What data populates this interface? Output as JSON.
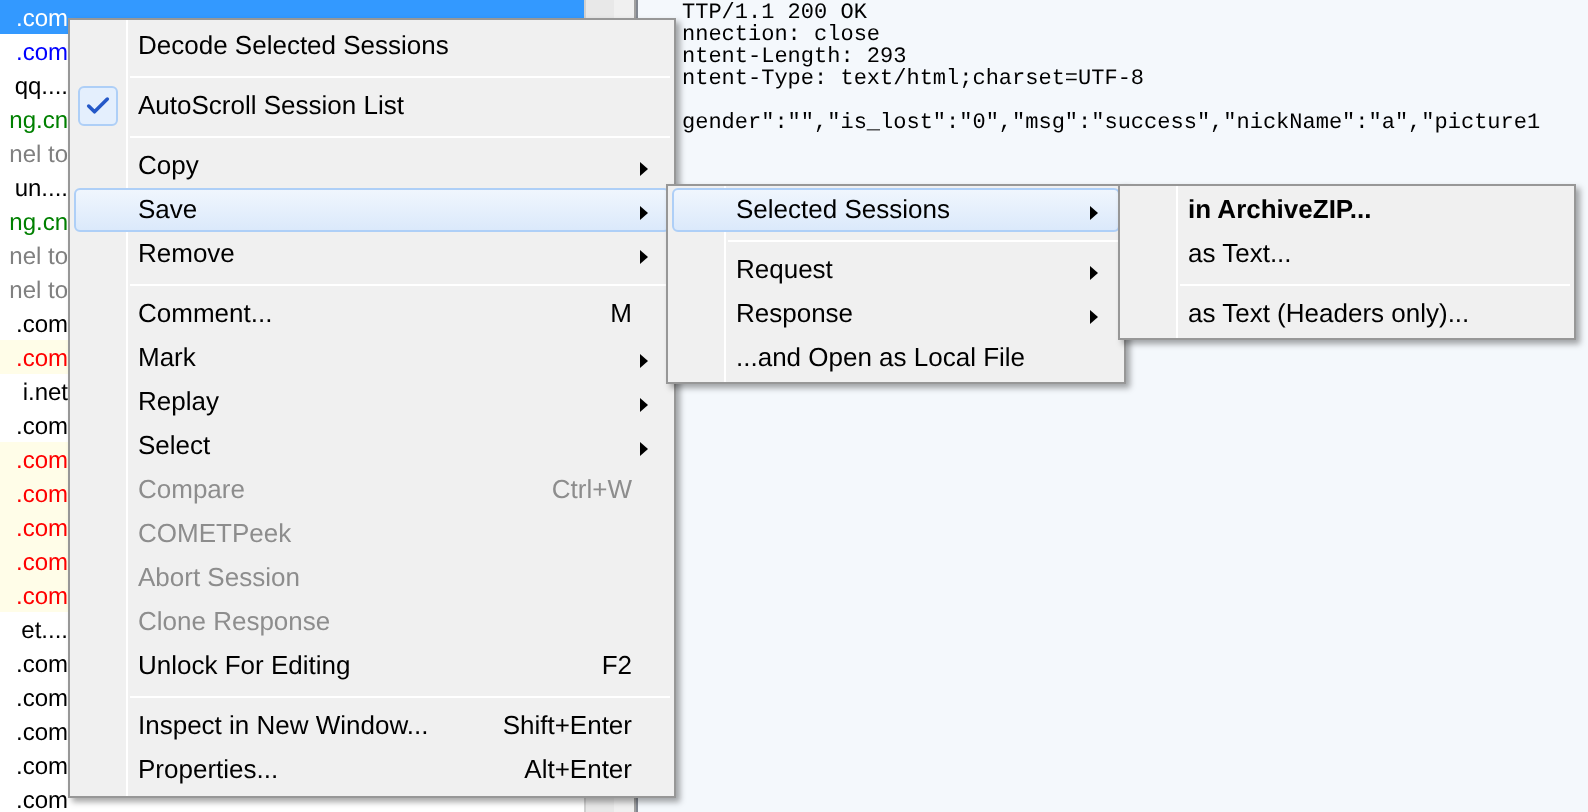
{
  "session_list": {
    "rows": [
      {
        "host": ".com",
        "selected": true,
        "flagged": false
      },
      {
        "host": ".com",
        "color": "#0000ff",
        "selected": false,
        "flagged": false
      },
      {
        "host": "qq....",
        "color": "#000000",
        "selected": false,
        "flagged": false
      },
      {
        "host": "ng.cn",
        "color": "#008000",
        "selected": false,
        "flagged": false
      },
      {
        "host": "nel to",
        "color": "#808080",
        "selected": false,
        "flagged": false
      },
      {
        "host": "un....",
        "color": "#000000",
        "selected": false,
        "flagged": false
      },
      {
        "host": "ng.cn",
        "color": "#008000",
        "selected": false,
        "flagged": false
      },
      {
        "host": "nel to",
        "color": "#808080",
        "selected": false,
        "flagged": false
      },
      {
        "host": "nel to",
        "color": "#808080",
        "selected": false,
        "flagged": false
      },
      {
        "host": ".com",
        "color": "#000000",
        "selected": false,
        "flagged": false
      },
      {
        "host": ".com",
        "color": "#ff0000",
        "selected": false,
        "flagged": true
      },
      {
        "host": "i.net",
        "color": "#000000",
        "selected": false,
        "flagged": false
      },
      {
        "host": ".com",
        "color": "#000000",
        "selected": false,
        "flagged": false
      },
      {
        "host": ".com",
        "color": "#ff0000",
        "selected": false,
        "flagged": true
      },
      {
        "host": ".com",
        "color": "#ff0000",
        "selected": false,
        "flagged": true
      },
      {
        "host": ".com",
        "color": "#ff0000",
        "selected": false,
        "flagged": true
      },
      {
        "host": ".com",
        "color": "#ff0000",
        "selected": false,
        "flagged": true
      },
      {
        "host": ".com",
        "color": "#ff0000",
        "selected": false,
        "flagged": true
      },
      {
        "host": "et....",
        "color": "#000000",
        "selected": false,
        "flagged": false
      },
      {
        "host": ".com",
        "color": "#000000",
        "selected": false,
        "flagged": false
      },
      {
        "host": ".com",
        "color": "#000000",
        "selected": false,
        "flagged": false
      },
      {
        "host": ".com",
        "color": "#000000",
        "selected": false,
        "flagged": false
      },
      {
        "host": ".com",
        "color": "#000000",
        "selected": false,
        "flagged": false
      },
      {
        "host": ".com",
        "color": "#000000",
        "selected": false,
        "flagged": false
      }
    ]
  },
  "response_view": {
    "headers": [
      "TTP/1.1 200 OK",
      "nnection: close",
      "ntent-Length: 293",
      "ntent-Type: text/html;charset=UTF-8"
    ],
    "body": "gender\":\"\",\"is_lost\":\"0\",\"msg\":\"success\",\"nickName\":\"a\",\"picture1"
  },
  "menus": [
    {
      "items": [
        {
          "kind": "command",
          "label": "Decode Selected Sessions",
          "submenu": false,
          "disabled": false,
          "selected": false,
          "checked": false
        },
        {
          "kind": "separator"
        },
        {
          "kind": "command",
          "label": "AutoScroll Session List",
          "submenu": false,
          "disabled": false,
          "selected": false,
          "checked": true
        },
        {
          "kind": "separator"
        },
        {
          "kind": "command",
          "label": "Copy",
          "submenu": true,
          "disabled": false,
          "selected": false,
          "checked": false
        },
        {
          "kind": "command",
          "label": "Save",
          "submenu": true,
          "disabled": false,
          "selected": true,
          "checked": false
        },
        {
          "kind": "command",
          "label": "Remove",
          "submenu": true,
          "disabled": false,
          "selected": false,
          "checked": false
        },
        {
          "kind": "separator"
        },
        {
          "kind": "command",
          "label": "Comment...",
          "shortcut": "M",
          "submenu": false,
          "disabled": false,
          "selected": false,
          "checked": false
        },
        {
          "kind": "command",
          "label": "Mark",
          "submenu": true,
          "disabled": false,
          "selected": false,
          "checked": false
        },
        {
          "kind": "command",
          "label": "Replay",
          "submenu": true,
          "disabled": false,
          "selected": false,
          "checked": false
        },
        {
          "kind": "command",
          "label": "Select",
          "submenu": true,
          "disabled": false,
          "selected": false,
          "checked": false
        },
        {
          "kind": "command",
          "label": "Compare",
          "shortcut": "Ctrl+W",
          "submenu": false,
          "disabled": true,
          "selected": false,
          "checked": false
        },
        {
          "kind": "command",
          "label": "COMETPeek",
          "submenu": false,
          "disabled": true,
          "selected": false,
          "checked": false
        },
        {
          "kind": "command",
          "label": "Abort Session",
          "submenu": false,
          "disabled": true,
          "selected": false,
          "checked": false
        },
        {
          "kind": "command",
          "label": "Clone Response",
          "submenu": false,
          "disabled": true,
          "selected": false,
          "checked": false
        },
        {
          "kind": "command",
          "label": "Unlock For Editing",
          "shortcut": "F2",
          "submenu": false,
          "disabled": false,
          "selected": false,
          "checked": false
        },
        {
          "kind": "separator"
        },
        {
          "kind": "command",
          "label": "Inspect in New Window...",
          "shortcut": "Shift+Enter",
          "submenu": false,
          "disabled": false,
          "selected": false,
          "checked": false
        },
        {
          "kind": "command",
          "label": "Properties...",
          "shortcut": "Alt+Enter",
          "submenu": false,
          "disabled": false,
          "selected": false,
          "checked": false
        }
      ]
    },
    {
      "items": [
        {
          "kind": "command",
          "label": "Selected Sessions",
          "submenu": true,
          "disabled": false,
          "selected": true,
          "checked": false
        },
        {
          "kind": "separator"
        },
        {
          "kind": "command",
          "label": "Request",
          "submenu": true,
          "disabled": false,
          "selected": false,
          "checked": false
        },
        {
          "kind": "command",
          "label": "Response",
          "submenu": true,
          "disabled": false,
          "selected": false,
          "checked": false
        },
        {
          "kind": "command",
          "label": "...and Open as Local File",
          "submenu": false,
          "disabled": false,
          "selected": false,
          "checked": false
        }
      ]
    },
    {
      "items": [
        {
          "kind": "command",
          "label": "in ArchiveZIP...",
          "submenu": false,
          "disabled": false,
          "selected": false,
          "checked": false,
          "default": true
        },
        {
          "kind": "command",
          "label": "as Text...",
          "submenu": false,
          "disabled": false,
          "selected": false,
          "checked": false,
          "default": false
        },
        {
          "kind": "separator"
        },
        {
          "kind": "command",
          "label": "as Text (Headers only)...",
          "submenu": false,
          "disabled": false,
          "selected": false,
          "checked": false,
          "default": false
        }
      ]
    }
  ]
}
